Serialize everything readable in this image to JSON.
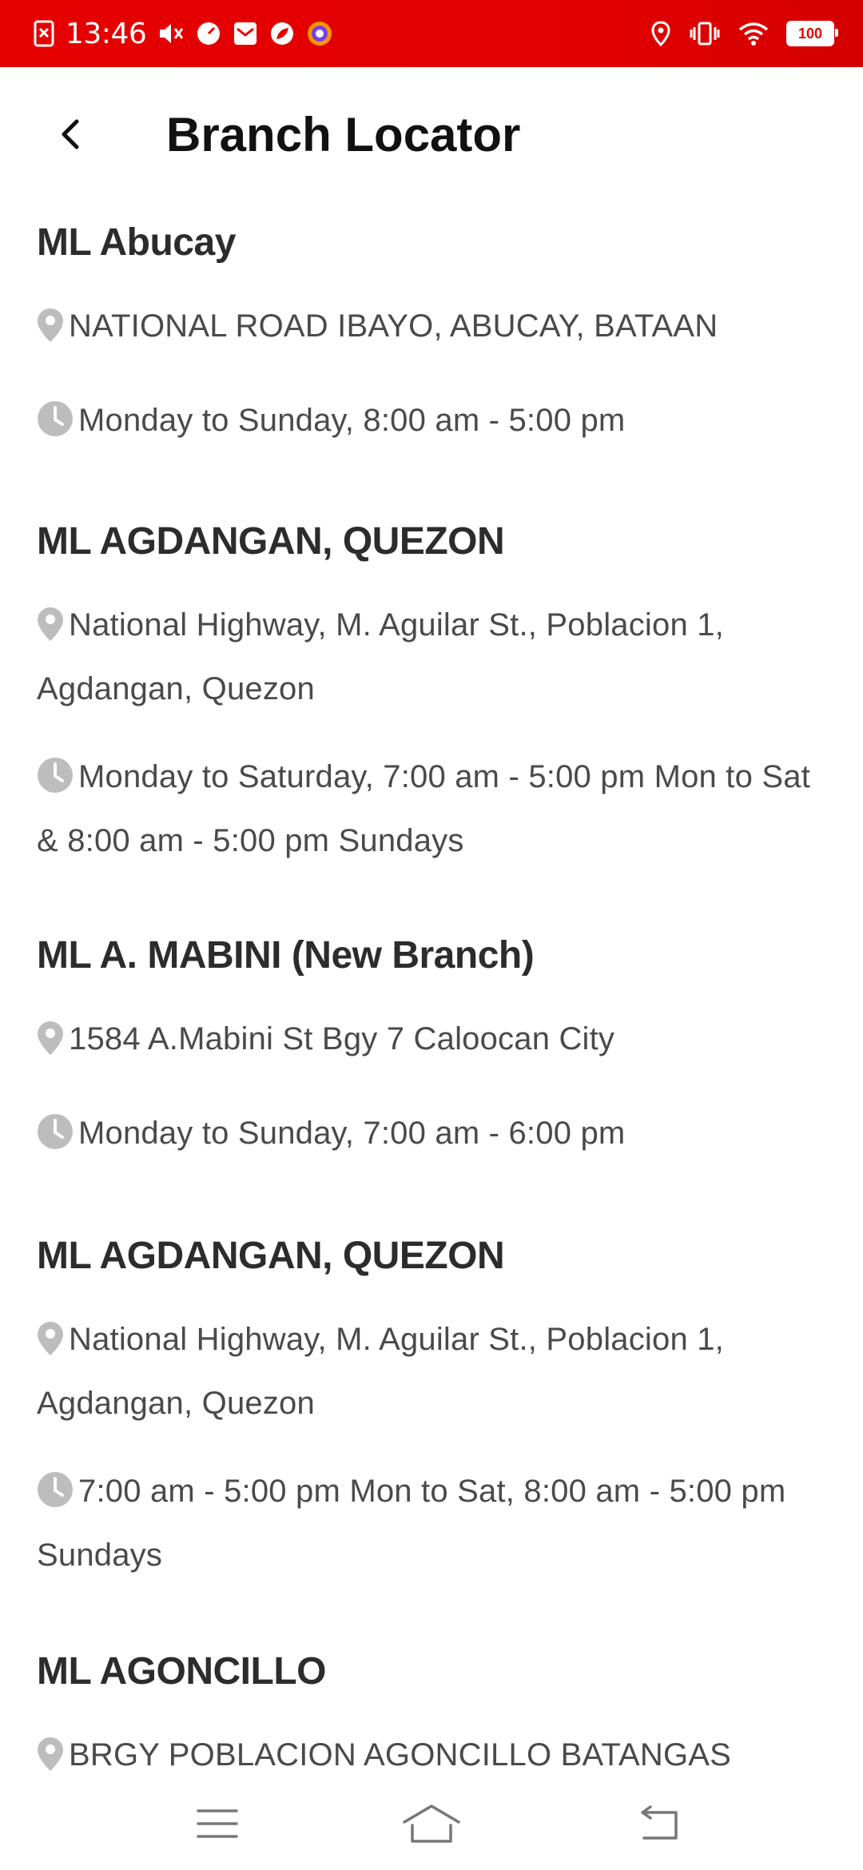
{
  "status_bar": {
    "time": "13:46",
    "battery": "100",
    "background": "#e60000"
  },
  "app_bar": {
    "title": "Branch Locator",
    "back_icon": "chevron-left-icon"
  },
  "branches": [
    {
      "name": "ML Abucay",
      "address": "NATIONAL ROAD IBAYO, ABUCAY, BATAAN",
      "hours": "Monday to Sunday, 8:00 am - 5:00 pm"
    },
    {
      "name": "ML AGDANGAN, QUEZON",
      "address": "National Highway, M. Aguilar St., Poblacion 1, Agdangan, Quezon",
      "hours": "Monday to Saturday, 7:00 am - 5:00 pm Mon to Sat & 8:00 am - 5:00 pm Sundays"
    },
    {
      "name": "ML A. MABINI (New Branch)",
      "address": "1584 A.Mabini St Bgy 7 Caloocan City",
      "hours": "Monday to Sunday, 7:00 am - 6:00 pm"
    },
    {
      "name": "ML AGDANGAN, QUEZON",
      "address": "National Highway, M. Aguilar St., Poblacion 1, Agdangan, Quezon",
      "hours": "7:00 am - 5:00 pm Mon to Sat, 8:00 am - 5:00 pm Sundays"
    },
    {
      "name": "ML AGONCILLO",
      "address": "BRGY POBLACION AGONCILLO BATANGAS"
    }
  ],
  "icons": {
    "address": "map-pin-icon",
    "hours": "clock-icon",
    "icon_color": "#bdbdbd"
  },
  "nav_bar": {
    "menu": "menu-icon",
    "home": "home-icon",
    "back": "back-icon"
  }
}
